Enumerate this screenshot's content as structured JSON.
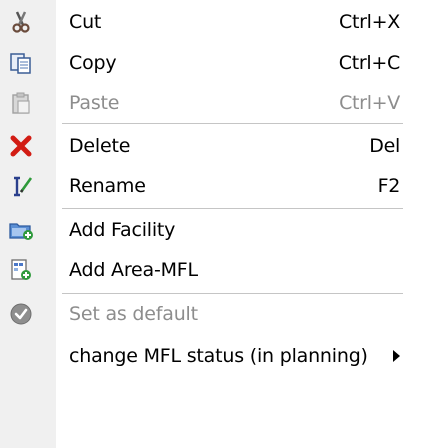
{
  "menu": {
    "items": [
      {
        "label": "Cut",
        "shortcut": "Ctrl+X",
        "icon": "scissors-icon",
        "enabled": true
      },
      {
        "label": "Copy",
        "shortcut": "Ctrl+C",
        "icon": "copy-icon",
        "enabled": true
      },
      {
        "label": "Paste",
        "shortcut": "Ctrl+V",
        "icon": "paste-icon",
        "enabled": false
      },
      {
        "label": "Delete",
        "shortcut": "Del",
        "icon": "delete-x-icon",
        "enabled": true
      },
      {
        "label": "Rename",
        "shortcut": "F2",
        "icon": "rename-icon",
        "enabled": true
      },
      {
        "label": "Add Facility",
        "shortcut": "",
        "icon": "add-folder-icon",
        "enabled": true
      },
      {
        "label": "Add Area-MFL",
        "shortcut": "",
        "icon": "add-area-icon",
        "enabled": true
      },
      {
        "label": "Set as default",
        "shortcut": "",
        "icon": "check-circle-icon",
        "enabled": false
      },
      {
        "label": "change MFL status (in planning)",
        "shortcut": "",
        "icon": "",
        "enabled": true,
        "submenu": true
      }
    ]
  },
  "colors": {
    "gutter": "#f0f0f0",
    "disabled_text": "#8d8d8d",
    "delete_red": "#d21c14",
    "separator": "#c5c5c5"
  }
}
